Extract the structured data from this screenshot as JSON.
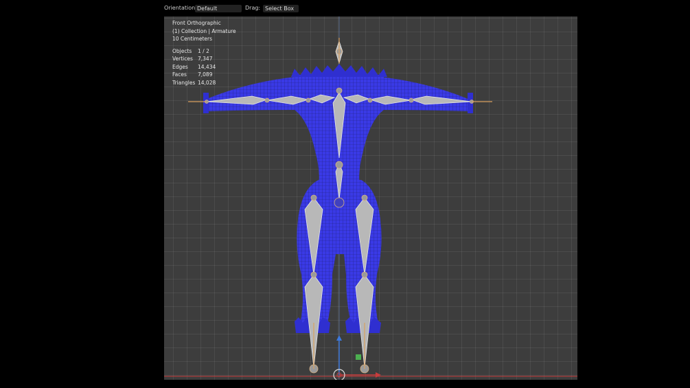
{
  "header": {
    "orientation_label": "Orientation:",
    "orientation_value": "Default",
    "drag_label": "Drag:",
    "drag_value": "Select Box"
  },
  "overlay": {
    "view_name": "Front Orthographic",
    "collection": "(1) Collection | Armature",
    "scale": "10 Centimeters"
  },
  "stats": [
    {
      "label": "Objects",
      "value": "1 / 2"
    },
    {
      "label": "Vertices",
      "value": "7,347"
    },
    {
      "label": "Edges",
      "value": "14,434"
    },
    {
      "label": "Faces",
      "value": "7,089"
    },
    {
      "label": "Triangles",
      "value": "14,028"
    }
  ],
  "colors": {
    "mesh": "#3a3ae6",
    "wire": "#1a1a66",
    "bone": "#b8b8b8",
    "bone_outline": "#e0e0e0",
    "joint": "#c8a070",
    "grid_bg": "#3d3d3d",
    "x_axis": "#c83c3c",
    "z_axis": "#3c78dc"
  }
}
